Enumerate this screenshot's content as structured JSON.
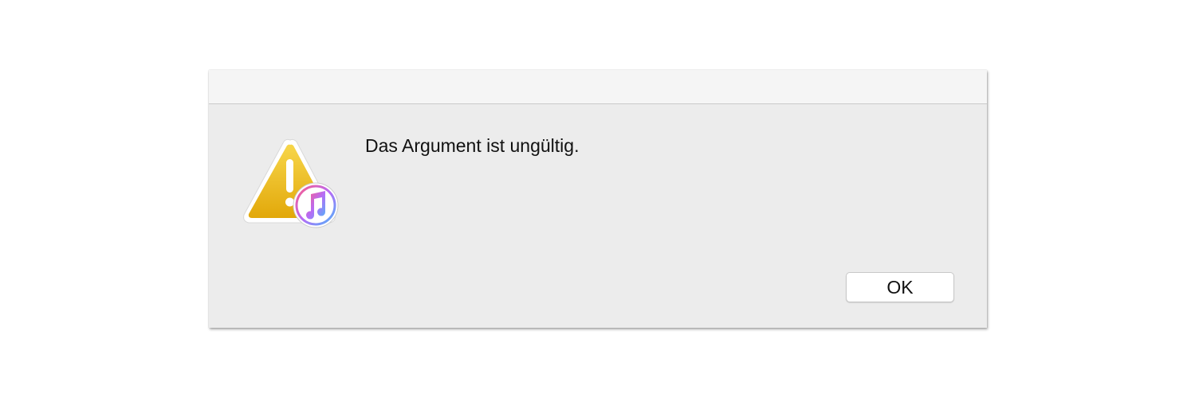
{
  "dialog": {
    "message": "Das Argument ist ungültig.",
    "ok_label": "OK",
    "icon": "itunes-warning-icon"
  },
  "colors": {
    "warning_yellow": "#f0c419",
    "dialog_background": "#ececec",
    "titlebar_background": "#f5f5f5"
  }
}
